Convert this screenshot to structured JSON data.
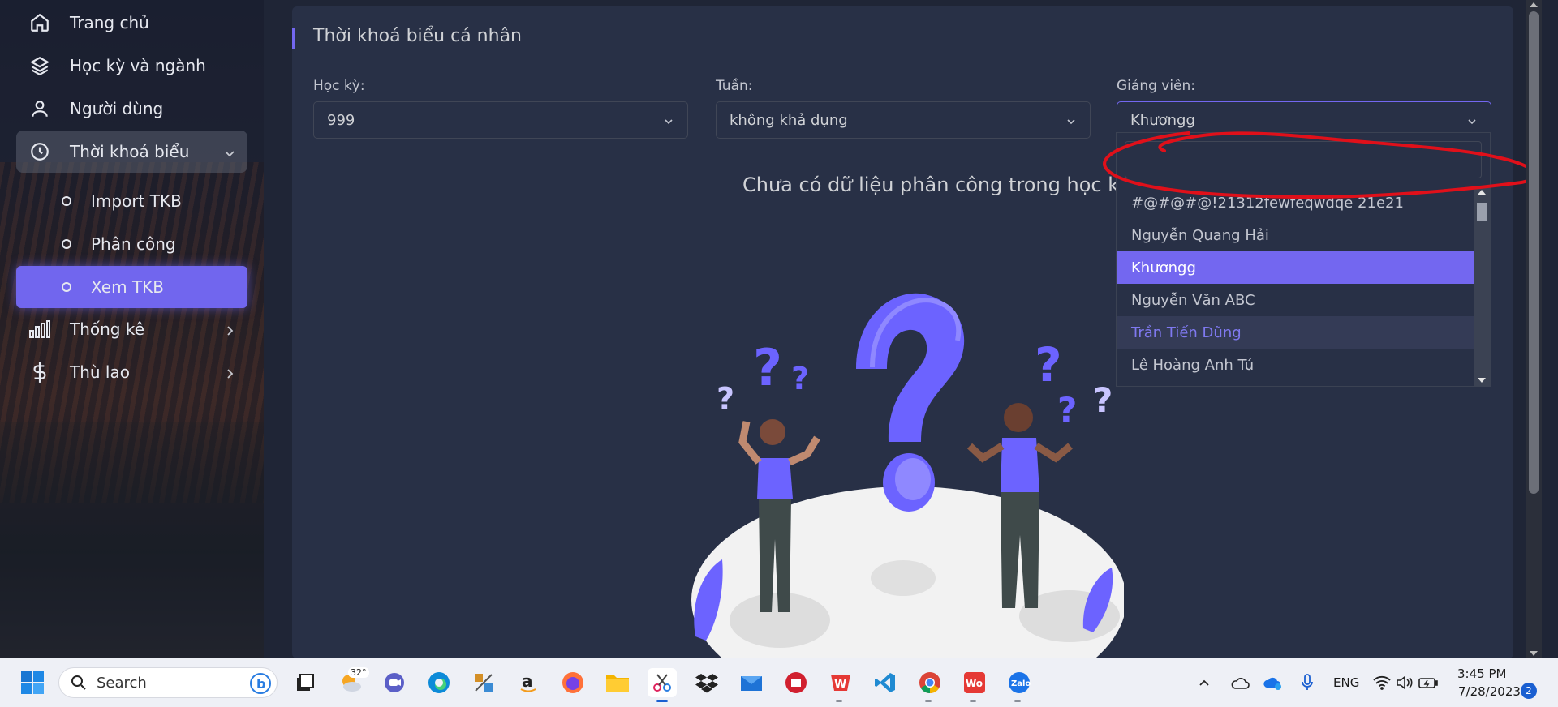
{
  "sidebar": {
    "items": [
      {
        "label": "Trang chủ",
        "icon": "home-icon"
      },
      {
        "label": "Học kỳ và ngành",
        "icon": "layers-icon"
      },
      {
        "label": "Người dùng",
        "icon": "user-icon"
      },
      {
        "label": "Thời khoá biểu",
        "icon": "clock-icon"
      },
      {
        "label": "Thống kê",
        "icon": "bar-chart-icon"
      },
      {
        "label": "Thù lao",
        "icon": "dollar-icon"
      }
    ],
    "subitems": [
      {
        "label": "Import TKB"
      },
      {
        "label": "Phân công"
      },
      {
        "label": "Xem TKB"
      }
    ]
  },
  "main": {
    "title": "Thời khoá biểu cá nhân",
    "filters": {
      "semester": {
        "label": "Học kỳ:",
        "value": "999"
      },
      "week": {
        "label": "Tuần:",
        "value": "không khả dụng"
      },
      "lecturer": {
        "label": "Giảng viên:",
        "value": "Khươngg"
      }
    },
    "empty_message": "Chưa có dữ liệu phân công trong học kỳ",
    "dropdown": {
      "search_value": "",
      "options": [
        "#@#@#@!21312fewfeqwdqe 21e21",
        "Nguyễn Quang Hải",
        "Khươngg",
        "Nguyễn Văn ABC",
        "Trần Tiến Dũng",
        "Lê Hoàng Anh Tú"
      ],
      "selected_index": 2,
      "hover_index": 4
    }
  },
  "taskbar": {
    "search_label": "Search",
    "weather_temp": "32°",
    "language": "ENG",
    "time": "3:45 PM",
    "date": "7/28/2023",
    "notification_count": "2"
  },
  "colors": {
    "accent": "#7367f0",
    "card_bg": "#283046",
    "page_bg": "#1f2536",
    "annotation_red": "#e0101a"
  }
}
